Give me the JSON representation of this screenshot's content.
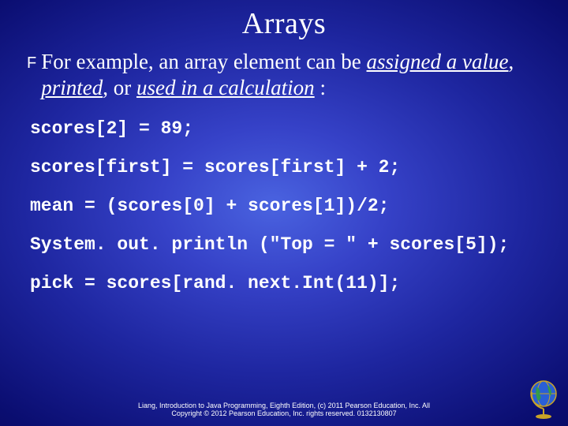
{
  "title": "Arrays",
  "bullet": {
    "icon": "F",
    "text_parts": {
      "p0": "For example, an array element can be ",
      "p1": "assigned a value",
      "p2": ", ",
      "p3": "printed",
      "p4": ", or ",
      "p5": "used in a calculation",
      "p6": " :"
    }
  },
  "code": {
    "l1": "scores[2] = 89;",
    "l2": "scores[first] = scores[first] + 2;",
    "l3": "mean = (scores[0] + scores[1])/2;",
    "l4": "System. out. println (\"Top = \" + scores[5]);",
    "l5": "pick = scores[rand. next.Int(11)];"
  },
  "footer": {
    "line1": "Liang, Introduction to Java Programming, Eighth Edition, (c) 2011 Pearson Education, Inc. All",
    "line2": "Copyright © 2012 Pearson Education, Inc.   rights reserved. 0132130807"
  }
}
